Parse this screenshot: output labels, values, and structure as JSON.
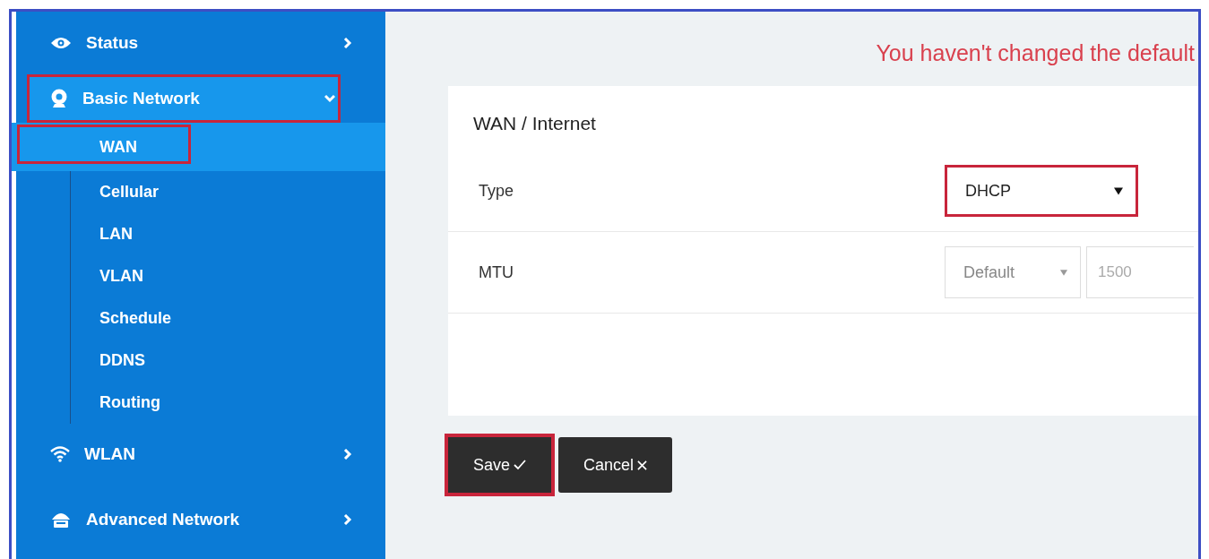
{
  "sidebar": {
    "items": [
      {
        "label": "Status",
        "kind": "eye",
        "expanded": false,
        "highlighted": false
      },
      {
        "label": "Basic Network",
        "kind": "globe",
        "expanded": true,
        "highlighted": true,
        "children": [
          {
            "label": "WAN",
            "selected": true,
            "highlighted": true
          },
          {
            "label": "Cellular",
            "selected": false,
            "highlighted": false
          },
          {
            "label": "LAN",
            "selected": false,
            "highlighted": false
          },
          {
            "label": "VLAN",
            "selected": false,
            "highlighted": false
          },
          {
            "label": "Schedule",
            "selected": false,
            "highlighted": false
          },
          {
            "label": "DDNS",
            "selected": false,
            "highlighted": false
          },
          {
            "label": "Routing",
            "selected": false,
            "highlighted": false
          }
        ]
      },
      {
        "label": "WLAN",
        "kind": "wifi",
        "expanded": false,
        "highlighted": false
      },
      {
        "label": "Advanced Network",
        "kind": "network",
        "expanded": false,
        "highlighted": false
      }
    ]
  },
  "warning": "You haven't changed the default",
  "card": {
    "title": "WAN / Internet",
    "rows": [
      {
        "label": "Type",
        "select": {
          "value": "DHCP",
          "disabled": false,
          "highlighted": true
        }
      },
      {
        "label": "MTU",
        "select": {
          "value": "Default",
          "disabled": true,
          "highlighted": false
        },
        "input": {
          "placeholder": "1500"
        }
      }
    ]
  },
  "buttons": [
    {
      "label": "Save",
      "kind": "save",
      "highlighted": true
    },
    {
      "label": "Cancel",
      "kind": "cancel",
      "highlighted": false
    }
  ]
}
